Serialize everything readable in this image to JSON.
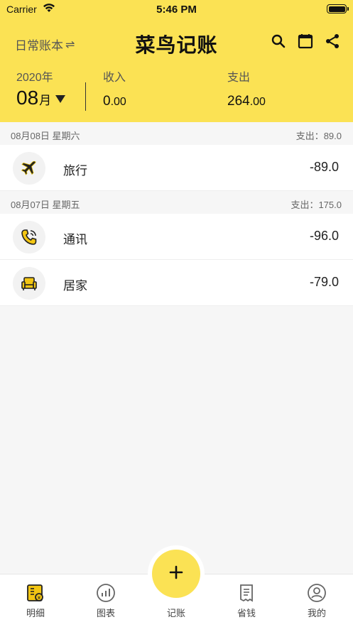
{
  "status_bar": {
    "carrier": "Carrier",
    "time": "5:46 PM"
  },
  "header": {
    "book_name": "日常账本",
    "book_switch_glyph": "⇌",
    "title": "菜鸟记账",
    "icons": [
      "search-icon",
      "calendar-icon",
      "share-icon"
    ]
  },
  "summary": {
    "year": "2020年",
    "month": "08",
    "month_unit": "月",
    "income_label": "收入",
    "income_int": "0",
    "income_dec": ".00",
    "expense_label": "支出",
    "expense_int": "264",
    "expense_dec": ".00"
  },
  "days": [
    {
      "date": "08月08日  星期六",
      "total": "支出：89.0",
      "records": [
        {
          "category": "旅行",
          "amount": "-89.0",
          "icon": "airplane-icon"
        }
      ]
    },
    {
      "date": "08月07日  星期五",
      "total": "支出：175.0",
      "records": [
        {
          "category": "通讯",
          "amount": "-96.0",
          "icon": "phone-icon"
        },
        {
          "category": "居家",
          "amount": "-79.0",
          "icon": "armchair-icon"
        }
      ]
    }
  ],
  "tabbar": {
    "tabs": [
      {
        "label": "明细",
        "icon": "ledger-icon",
        "active": true
      },
      {
        "label": "图表",
        "icon": "chart-icon",
        "active": false
      },
      {
        "label": "记账",
        "icon": "plus-icon",
        "active": false
      },
      {
        "label": "省钱",
        "icon": "receipt-icon",
        "active": false
      },
      {
        "label": "我的",
        "icon": "profile-icon",
        "active": false
      }
    ]
  },
  "colors": {
    "accent": "#fbe254",
    "background": "#f6f6f6",
    "card": "#ffffff"
  }
}
